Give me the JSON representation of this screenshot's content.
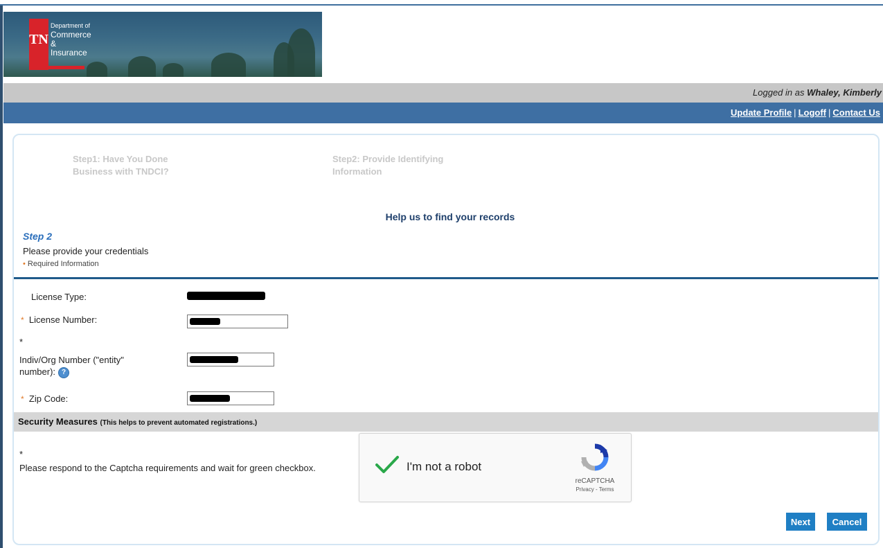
{
  "header": {
    "logo": {
      "tn": "TN",
      "line1": "Department of",
      "line2": "Commerce &",
      "line3": "Insurance"
    },
    "logged_in_prefix": "Logged in as ",
    "logged_in_user": "Whaley, Kimberly",
    "links": {
      "update_profile": "Update Profile",
      "logoff": "Logoff",
      "contact_us": "Contact Us",
      "separator": "|"
    }
  },
  "steps": [
    {
      "label": "Step1: Have You Done Business with TNDCI?"
    },
    {
      "label": "Step2: Provide Identifying Information"
    }
  ],
  "main": {
    "title": "Help us to find your records",
    "step_label": "Step 2",
    "instruction": "Please provide your credentials",
    "required_note": "Required Information"
  },
  "form": {
    "license_type_label": "License Type:",
    "license_number_label": "License Number:",
    "entity_number_label": "Indiv/Org Number (\"entity\" number):",
    "zip_code_label": "Zip Code:",
    "required_marker": "*",
    "info_icon_glyph": "?"
  },
  "security": {
    "title": "Security Measures",
    "subtitle": "(This helps to prevent automated registrations.)",
    "captcha_instruction": "Please respond to the Captcha requirements and wait for green checkbox.",
    "recaptcha": {
      "label": "I'm not a robot",
      "brand": "reCAPTCHA",
      "privacy_terms": "Privacy - Terms",
      "checked": true
    }
  },
  "buttons": {
    "next": "Next",
    "cancel": "Cancel"
  },
  "colors": {
    "accent_blue": "#3e6fa3",
    "button_blue": "#1f7fc4",
    "required_orange": "#e07b2a",
    "check_green": "#2aa84a"
  }
}
